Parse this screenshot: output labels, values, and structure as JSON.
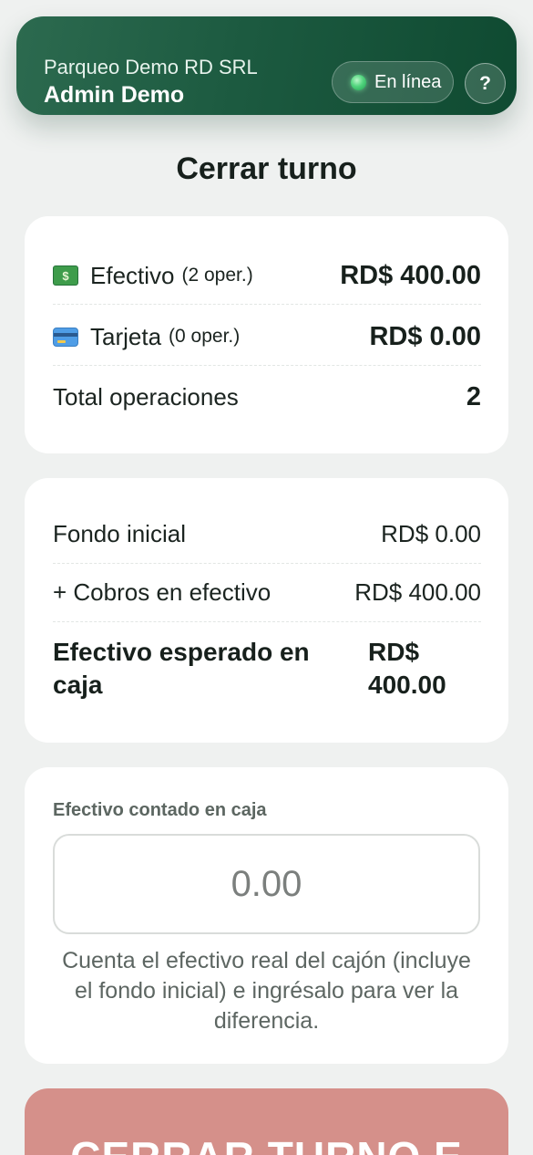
{
  "header": {
    "company": "Parqueo Demo RD SRL",
    "user": "Admin Demo",
    "status": "En línea",
    "help_symbol": "?",
    "status_icon": "online-dot-icon",
    "help_icon": "question-icon"
  },
  "page_title": "Cerrar turno",
  "summary": {
    "cash": {
      "label": "Efectivo",
      "ops": "(2 oper.)",
      "amount": "RD$ 400.00",
      "icon": "money-icon"
    },
    "card": {
      "label": "Tarjeta",
      "ops": "(0 oper.)",
      "amount": "RD$ 0.00",
      "icon": "credit-card-icon"
    },
    "total": {
      "label": "Total operaciones",
      "value": "2"
    }
  },
  "cash_breakdown": {
    "initial": {
      "label": "Fondo inicial",
      "value": "RD$ 0.00"
    },
    "collections": {
      "label": "+ Cobros en efectivo",
      "value": "RD$ 400.00"
    },
    "expected": {
      "label": "Efectivo esperado en caja",
      "value": "RD$ 400.00"
    }
  },
  "counted": {
    "label": "Efectivo contado en caja",
    "placeholder": "0.00",
    "value": "",
    "hint": "Cuenta el efectivo real del cajón (incluye el fondo inicial) e ingrésalo para ver la diferencia."
  },
  "close_button": {
    "label": "CERRAR TURNO E"
  },
  "colors": {
    "header_start": "#2c6a4f",
    "header_end": "#0f4a31",
    "online": "#52d57e",
    "close_button": "#d5908a",
    "background": "#eff1f0"
  }
}
